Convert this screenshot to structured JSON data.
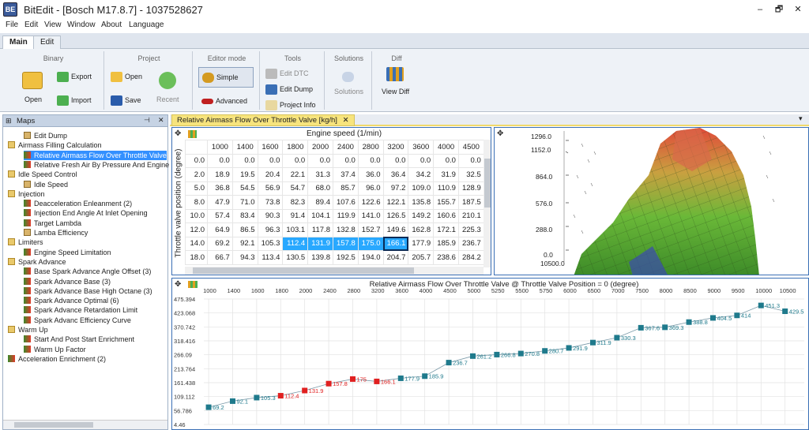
{
  "window": {
    "app_icon_text": "BE",
    "title": "BitEdit - [Bosch M17.8.7] - 1037528627",
    "minimize": "–",
    "restore": "🗗",
    "close": "✕"
  },
  "menu": [
    "File",
    "Edit",
    "View",
    "Window",
    "About",
    "Language"
  ],
  "ribbon_tabs": [
    "Main",
    "Edit"
  ],
  "ribbon": {
    "binary": {
      "title": "Binary",
      "open": "Open",
      "export": "Export",
      "import": "Import"
    },
    "project": {
      "title": "Project",
      "open": "Open",
      "save": "Save",
      "recent": "Recent"
    },
    "editor_mode": {
      "title": "Editor mode",
      "simple": "Simple",
      "advanced": "Advanced"
    },
    "tools": {
      "title": "Tools",
      "edit_dtc": "Edit DTC",
      "edit_dump": "Edit Dump",
      "project_info": "Project Info"
    },
    "solutions": {
      "title": "Solutions",
      "solutions": "Solutions"
    },
    "diff": {
      "title": "Diff",
      "view_diff": "View Diff"
    }
  },
  "maps_panel": {
    "title": "Maps",
    "pin": "⊣",
    "close": "✕",
    "items": [
      {
        "label": "Edit Dump",
        "indent": 1,
        "icon": "grid",
        "selected": false
      },
      {
        "label": "Airmass Filling Calculation",
        "indent": 0,
        "icon": "folder",
        "selected": false
      },
      {
        "label": "Relative Airmass Flow Over Throttle Valve",
        "indent": 1,
        "icon": "map",
        "selected": true
      },
      {
        "label": "Relative Fresh Air By Pressure And Engine",
        "indent": 1,
        "icon": "map",
        "selected": false
      },
      {
        "label": "Idle Speed Control",
        "indent": 0,
        "icon": "folder",
        "selected": false
      },
      {
        "label": "Idle Speed",
        "indent": 1,
        "icon": "grid",
        "selected": false
      },
      {
        "label": "Injection",
        "indent": 0,
        "icon": "folder",
        "selected": false
      },
      {
        "label": "Deacceleration Enleanment (2)",
        "indent": 1,
        "icon": "map",
        "selected": false
      },
      {
        "label": "Injection End Angle At Inlet Opening",
        "indent": 1,
        "icon": "map",
        "selected": false
      },
      {
        "label": "Target Lambda",
        "indent": 1,
        "icon": "map",
        "selected": false
      },
      {
        "label": "Lamba Efficiency",
        "indent": 1,
        "icon": "grid",
        "selected": false
      },
      {
        "label": "Limiters",
        "indent": 0,
        "icon": "folder",
        "selected": false
      },
      {
        "label": "Engine Speed Limitation",
        "indent": 1,
        "icon": "map",
        "selected": false
      },
      {
        "label": "Spark Advance",
        "indent": 0,
        "icon": "folder",
        "selected": false
      },
      {
        "label": "Base Spark Advance Angle Offset (3)",
        "indent": 1,
        "icon": "map",
        "selected": false
      },
      {
        "label": "Spark Advance Base (3)",
        "indent": 1,
        "icon": "map",
        "selected": false
      },
      {
        "label": "Spark Advance Base High Octane (3)",
        "indent": 1,
        "icon": "map",
        "selected": false
      },
      {
        "label": "Spark Advance Optimal (6)",
        "indent": 1,
        "icon": "map",
        "selected": false
      },
      {
        "label": "Spark Advance Retardation Limit",
        "indent": 1,
        "icon": "map",
        "selected": false
      },
      {
        "label": "Spark Advanc Efficiency Curve",
        "indent": 1,
        "icon": "map",
        "selected": false
      },
      {
        "label": "Warm Up",
        "indent": 0,
        "icon": "folder",
        "selected": false
      },
      {
        "label": "Start And Post Start Enrichment",
        "indent": 1,
        "icon": "map",
        "selected": false
      },
      {
        "label": "Warm Up Factor",
        "indent": 1,
        "icon": "map",
        "selected": false
      },
      {
        "label": "Acceleration Enrichment (2)",
        "indent": 0,
        "icon": "map",
        "selected": false
      }
    ]
  },
  "doc_tab": {
    "label": "Relative Airmass Flow Over Throttle Valve [kg/h]",
    "close": "✕"
  },
  "table": {
    "x_title": "Engine speed (1/min)",
    "y_title": "Throttle valve position (degree)",
    "x_headers": [
      "1000",
      "1400",
      "1600",
      "1800",
      "2000",
      "2400",
      "2800",
      "3200",
      "3600",
      "4000",
      "4500"
    ],
    "rows": [
      {
        "y": "0.0",
        "values": [
          "0.0",
          "0.0",
          "0.0",
          "0.0",
          "0.0",
          "0.0",
          "0.0",
          "0.0",
          "0.0",
          "0.0",
          "0.0"
        ]
      },
      {
        "y": "2.0",
        "values": [
          "18.9",
          "19.5",
          "20.4",
          "22.1",
          "31.3",
          "37.4",
          "36.0",
          "36.4",
          "34.2",
          "31.9",
          "32.5"
        ]
      },
      {
        "y": "5.0",
        "values": [
          "36.8",
          "54.5",
          "56.9",
          "54.7",
          "68.0",
          "85.7",
          "96.0",
          "97.2",
          "109.0",
          "110.9",
          "128.9"
        ]
      },
      {
        "y": "8.0",
        "values": [
          "47.9",
          "71.0",
          "73.8",
          "82.3",
          "89.4",
          "107.6",
          "122.6",
          "122.1",
          "135.8",
          "155.7",
          "187.5"
        ]
      },
      {
        "y": "10.0",
        "values": [
          "57.4",
          "83.4",
          "90.3",
          "91.4",
          "104.1",
          "119.9",
          "141.0",
          "126.5",
          "149.2",
          "160.6",
          "210.1"
        ]
      },
      {
        "y": "12.0",
        "values": [
          "64.9",
          "86.5",
          "96.3",
          "103.1",
          "117.8",
          "132.8",
          "152.7",
          "149.6",
          "162.8",
          "172.1",
          "225.3"
        ]
      },
      {
        "y": "14.0",
        "values": [
          "69.2",
          "92.1",
          "105.3",
          "112.4",
          "131.9",
          "157.8",
          "175.0",
          "166.1",
          "177.9",
          "185.9",
          "236.7"
        ]
      },
      {
        "y": "18.0",
        "values": [
          "66.7",
          "94.3",
          "113.4",
          "130.5",
          "139.8",
          "192.5",
          "194.0",
          "204.7",
          "205.7",
          "238.6",
          "284.2"
        ]
      }
    ]
  },
  "graph3d": {
    "z_ticks": [
      "1296.0",
      "1152.0",
      "864.0",
      "576.0",
      "288.0",
      "0.0"
    ],
    "x_tick": "10500.0"
  },
  "chart_data": {
    "type": "line",
    "title": "Relative Airmass Flow Over Throttle Valve @ Throttle Valve Position = 0 (degree)",
    "xlabel": "",
    "ylabel": "",
    "categories": [
      "1000",
      "1400",
      "1600",
      "1800",
      "2000",
      "2400",
      "2800",
      "3200",
      "3600",
      "4000",
      "4500",
      "5000",
      "5250",
      "5500",
      "5750",
      "6000",
      "6500",
      "7000",
      "7500",
      "8000",
      "8500",
      "9000",
      "9500",
      "10000",
      "10500"
    ],
    "y_ticks": [
      "475.394",
      "423.068",
      "370.742",
      "318.416",
      "266.09",
      "213.764",
      "161.438",
      "109.112",
      "56.786",
      "4.46"
    ],
    "ylim": [
      4.46,
      475.394
    ],
    "grid": true,
    "series": [
      {
        "values": [
          69.2,
          92.1,
          105.3,
          112.4,
          131.9,
          157.8,
          175,
          166.1,
          177.9,
          185.9,
          236.7,
          261.2,
          266.8,
          270.8,
          280.7,
          291.9,
          311.9,
          330.3,
          367.6,
          369.3,
          388.8,
          404.5,
          414,
          451.3,
          429.5
        ],
        "highlighted_indices": [
          3,
          4,
          5,
          6,
          7
        ],
        "color": "#1f7a8c",
        "highlight_color": "#e02020"
      }
    ]
  }
}
